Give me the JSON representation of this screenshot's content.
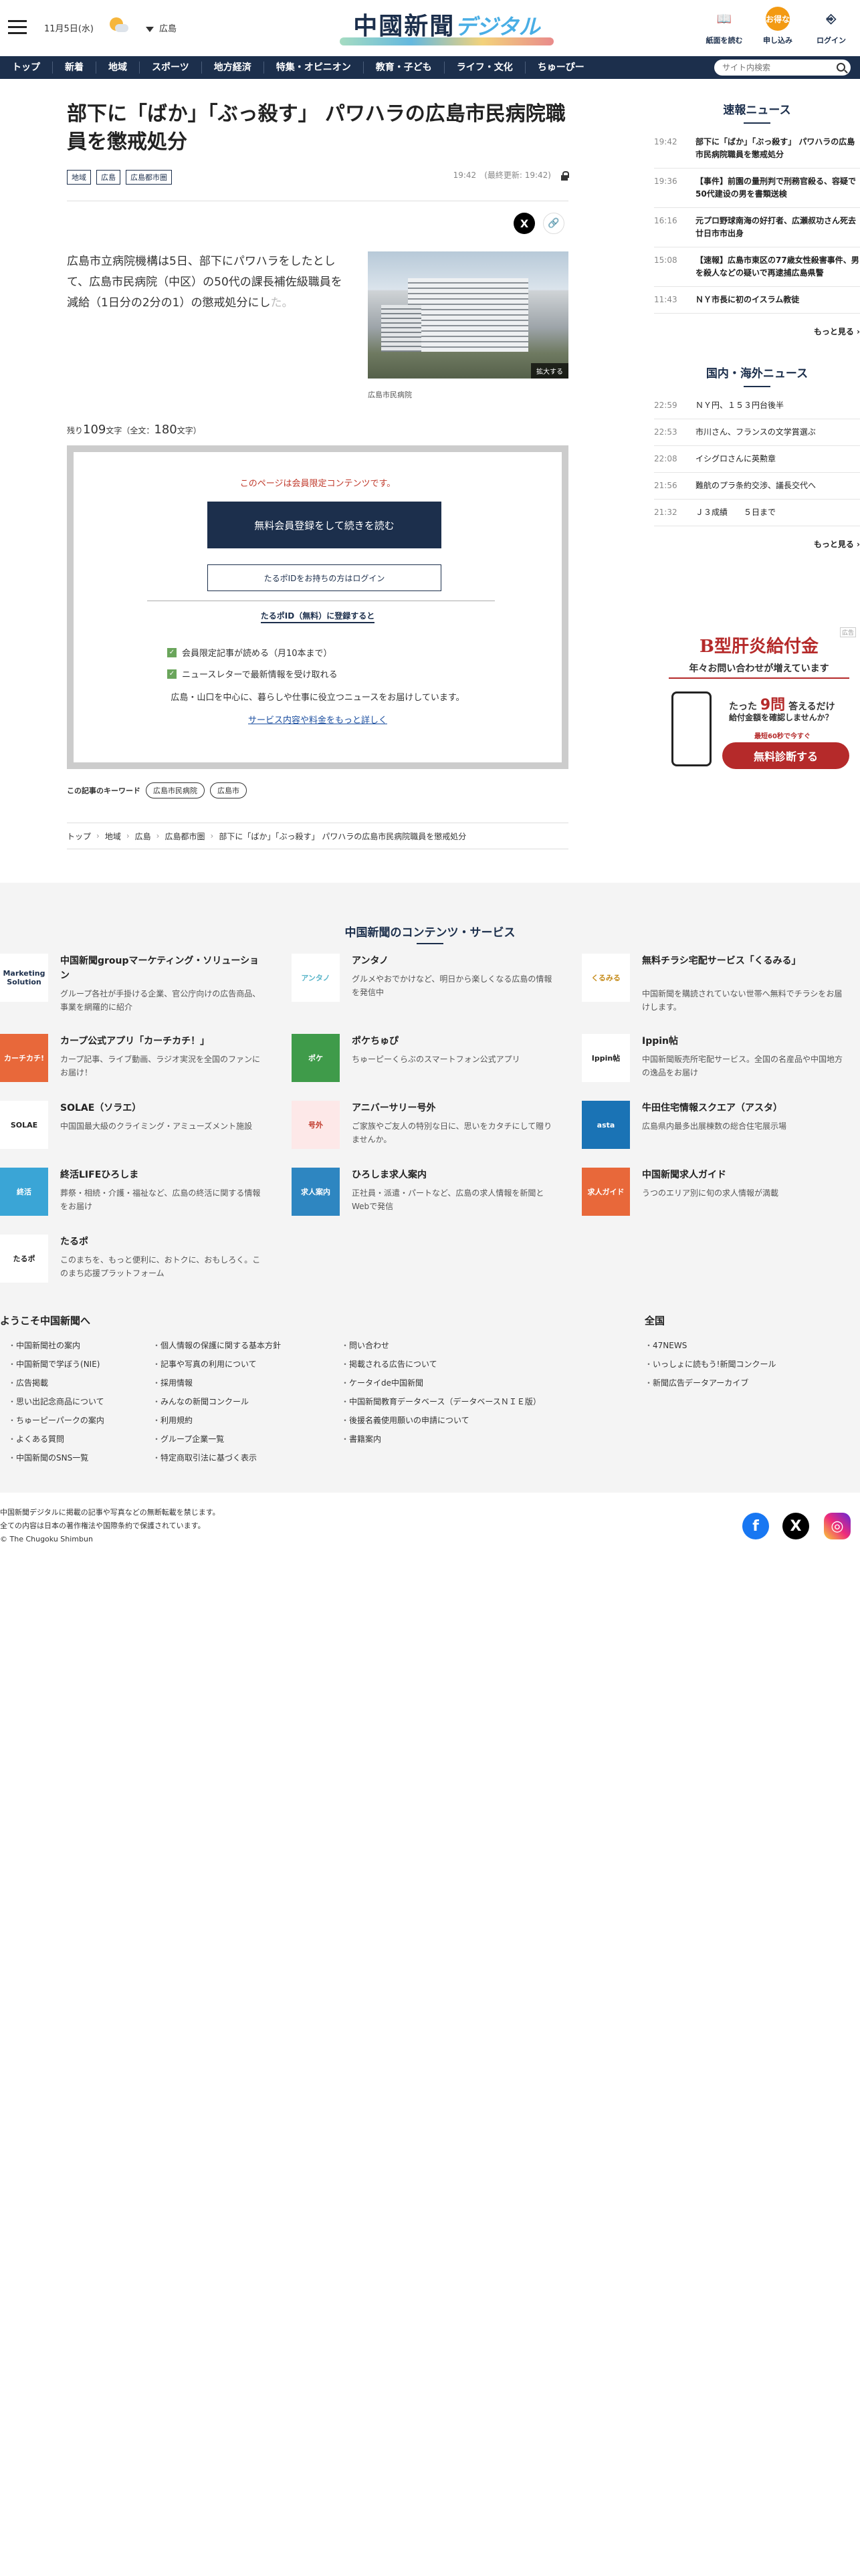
{
  "header": {
    "date": "11月5日(水)",
    "area": "広島",
    "logo_main": "中國新聞",
    "logo_sub": "デジタル",
    "btn_paper": "紙面を読む",
    "btn_apply": "申し込み",
    "btn_apply_badge": "お得な",
    "btn_login": "ログイン"
  },
  "nav": {
    "items": [
      "トップ",
      "新着",
      "地域",
      "スポーツ",
      "地方経済",
      "特集・オピニオン",
      "教育・子ども",
      "ライフ・文化",
      "ちゅーぴー"
    ],
    "search_placeholder": "サイト内検索"
  },
  "article": {
    "title": "部下に「ばか」「ぶっ殺す」 パワハラの広島市民病院職員を懲戒処分",
    "tags": [
      "地域",
      "広島",
      "広島都市圏"
    ],
    "time": "19:42",
    "updated": "(最終更新: 19:42)",
    "share_x": "X",
    "lead": "広島市立病院機構は5日、部下にパワハラをしたとして、広島市民病院（中区）の50代の課長補佐級職員を減給（1日分の2分の1）の懲戒処分にし",
    "lead_fade": "た。",
    "photo_enlarge": "拡大する",
    "caption": "広島市民病院",
    "remain_prefix": "残り",
    "remain_count": "109",
    "remain_mid": "文字（全文：",
    "total_count": "180",
    "remain_suffix": "文字）",
    "paywall": {
      "message": "このページは会員限定コンテンツです。",
      "cta": "無料会員登録をして続きを読む",
      "login": "たるポIDをお持ちの方はログイン",
      "register": "たるポID（無料）に登録すると",
      "benefit1": "会員限定記事が読める（月10本まで）",
      "benefit2": "ニュースレターで最新情報を受け取れる",
      "desc": "広島・山口を中心に、暮らしや仕事に役立つニュースをお届けしています。",
      "more": "サービス内容や料金をもっと詳しく"
    },
    "keywords_label": "この記事のキーワード",
    "keywords": [
      "広島市民病院",
      "広島市"
    ],
    "breadcrumb": [
      "トップ",
      "地域",
      "広島",
      "広島都市圏",
      "部下に「ばか」「ぶっ殺す」 パワハラの広島市民病院職員を懲戒処分"
    ]
  },
  "sidebar": {
    "flash_title": "速報ニュース",
    "flash": [
      {
        "time": "19:42",
        "headline": "部下に「ばか」「ぶっ殺す」 パワハラの広島市民病院職員を懲戒処分"
      },
      {
        "time": "19:36",
        "headline": "【事件】前園の量刑判で刑務官殺る、容疑で50代建设の男を書類送検"
      },
      {
        "time": "16:16",
        "headline": "元プロ野球南海の好打者、広瀬叔功さん死去　廿日市市出身"
      },
      {
        "time": "15:08",
        "headline": "【速報】広島市東区の77歳女性殺害事件、男を殺人などの疑いで再逮捕広島県警"
      },
      {
        "time": "11:43",
        "headline": "ＮＹ市長に初のイスラム教徒"
      }
    ],
    "world_title": "国内・海外ニュース",
    "world": [
      {
        "time": "22:59",
        "headline": "ＮＹ円、１５３円台後半"
      },
      {
        "time": "22:53",
        "headline": "市川さん、フランスの文学賞選ぶ"
      },
      {
        "time": "22:08",
        "headline": "イシグロさんに英勲章"
      },
      {
        "time": "21:56",
        "headline": "難航のプラ条約交渉、議長交代へ"
      },
      {
        "time": "21:32",
        "headline": "Ｊ３成績　　５日まで"
      }
    ],
    "more": "もっと見る"
  },
  "ad": {
    "badge": "広告",
    "title": "B型肝炎給付金",
    "sub": "年々お問い合わせが増えています",
    "q1_pre": "たった",
    "q1_num": "9問",
    "q1_post": "答えるだけ",
    "q2": "給付金額を確認しませんか？",
    "q3": "最短60秒で今すぐ",
    "button": "無料診断する"
  },
  "services": {
    "title": "中国新聞のコンテンツ・サービス",
    "items": [
      {
        "name": "中国新聞groupマーケティング・ソリューション",
        "desc": "グループ各社が手掛ける企業、官公庁向けの広告商品、事業を網羅的に紹介",
        "thumb": "Marketing Solution",
        "color": "#1c2f4c",
        "bg": "#fff"
      },
      {
        "name": "アンタノ",
        "desc": "グルメやおでかけなど、明日から楽しくなる広島の情報を発信中",
        "thumb": "アンタノ",
        "color": "#5ab5c9",
        "bg": "#fff"
      },
      {
        "name": "無料チラシ宅配サービス「くるみる」",
        "desc": "中国新聞を購読されていない世帯へ無料でチラシをお届けします。",
        "thumb": "くるみる",
        "color": "#c58b1a",
        "bg": "#fff"
      },
      {
        "name": "カープ公式アプリ「カーチカチ！」",
        "desc": "カープ記事、ライブ動画、ラジオ実況を全国のファンにお届け！",
        "thumb": "カーチカチ!",
        "color": "#fff",
        "bg": "#e8683a"
      },
      {
        "name": "ポケちゅぴ",
        "desc": "ちゅーピーくらぶのスマートフォン公式アプリ",
        "thumb": "ポケ",
        "color": "#fff",
        "bg": "#3f9b4a"
      },
      {
        "name": "Ippin帖",
        "desc": "中国新聞販売所宅配サービス。全国の名産品や中国地方の逸品をお届け",
        "thumb": "Ippin帖",
        "color": "#222",
        "bg": "#fff"
      },
      {
        "name": "SOLAE（ソラエ）",
        "desc": "中国国最大級のクライミング・アミューズメント施設",
        "thumb": "SOLAE",
        "color": "#222",
        "bg": "#fff"
      },
      {
        "name": "アニバーサリー号外",
        "desc": "ご家族やご友人の特別な日に、思いをカタチにして贈りませんか。",
        "thumb": "号外",
        "color": "#c0392b",
        "bg": "#fde8e8"
      },
      {
        "name": "牛田住宅情報スクエア（アスタ）",
        "desc": "広島県内最多出展棟数の総合住宅展示場",
        "thumb": "asta",
        "color": "#fff",
        "bg": "#1a73b5"
      },
      {
        "name": "終活LIFEひろしま",
        "desc": "葬祭・相続・介護・福祉など、広島の終活に関する情報をお届け",
        "thumb": "終活",
        "color": "#fff",
        "bg": "#3aa5d6"
      },
      {
        "name": "ひろしま求人案内",
        "desc": "正社員・派遣・パートなど、広島の求人情報を新聞とWebで発信",
        "thumb": "求人案内",
        "color": "#fff",
        "bg": "#2e86c1"
      },
      {
        "name": "中国新聞求人ガイド",
        "desc": "うつのエリア別に旬の求人情報が満載",
        "thumb": "求人ガイド",
        "color": "#fff",
        "bg": "#e8683a"
      },
      {
        "name": "たるポ",
        "desc": "このまちを、もっと便利に、おトクに、おもしろく。このまち応援プラットフォーム",
        "thumb": "たるポ",
        "color": "#222",
        "bg": "#fff"
      }
    ]
  },
  "welcome": {
    "title": "ようこそ中国新聞へ",
    "col1": [
      "中国新聞社の案内",
      "中国新聞で学ぼう(NIE)",
      "広告掲載",
      "思い出記念商品について",
      "ちゅーピーパークの案内",
      "よくある質問",
      "中国新聞のSNS一覧"
    ],
    "col2": [
      "個人情報の保護に関する基本方針",
      "記事や写真の利用について",
      "採用情報",
      "みんなの新聞コンクール",
      "利用規約",
      "グループ企業一覧",
      "特定商取引法に基づく表示"
    ],
    "col3": [
      "問い合わせ",
      "掲載される広告について",
      "ケータイde中国新聞",
      "中国新聞教育データベース（データベースＮＩＥ版）",
      "後援名義使用願いの申請について",
      "書籍案内"
    ],
    "national_title": "全国",
    "national": [
      "47NEWS",
      "いっしょに読もう!新聞コンクール",
      "新聞広告データアーカイブ"
    ]
  },
  "footer": {
    "line1": "中国新聞デジタルに掲載の記事や写真などの無断転載を禁じます。",
    "line2": "全ての内容は日本の著作権法や国際条約で保護されています。",
    "line3": "© The Chugoku Shimbun",
    "fb": "f",
    "x": "X",
    "ig": "◎"
  }
}
